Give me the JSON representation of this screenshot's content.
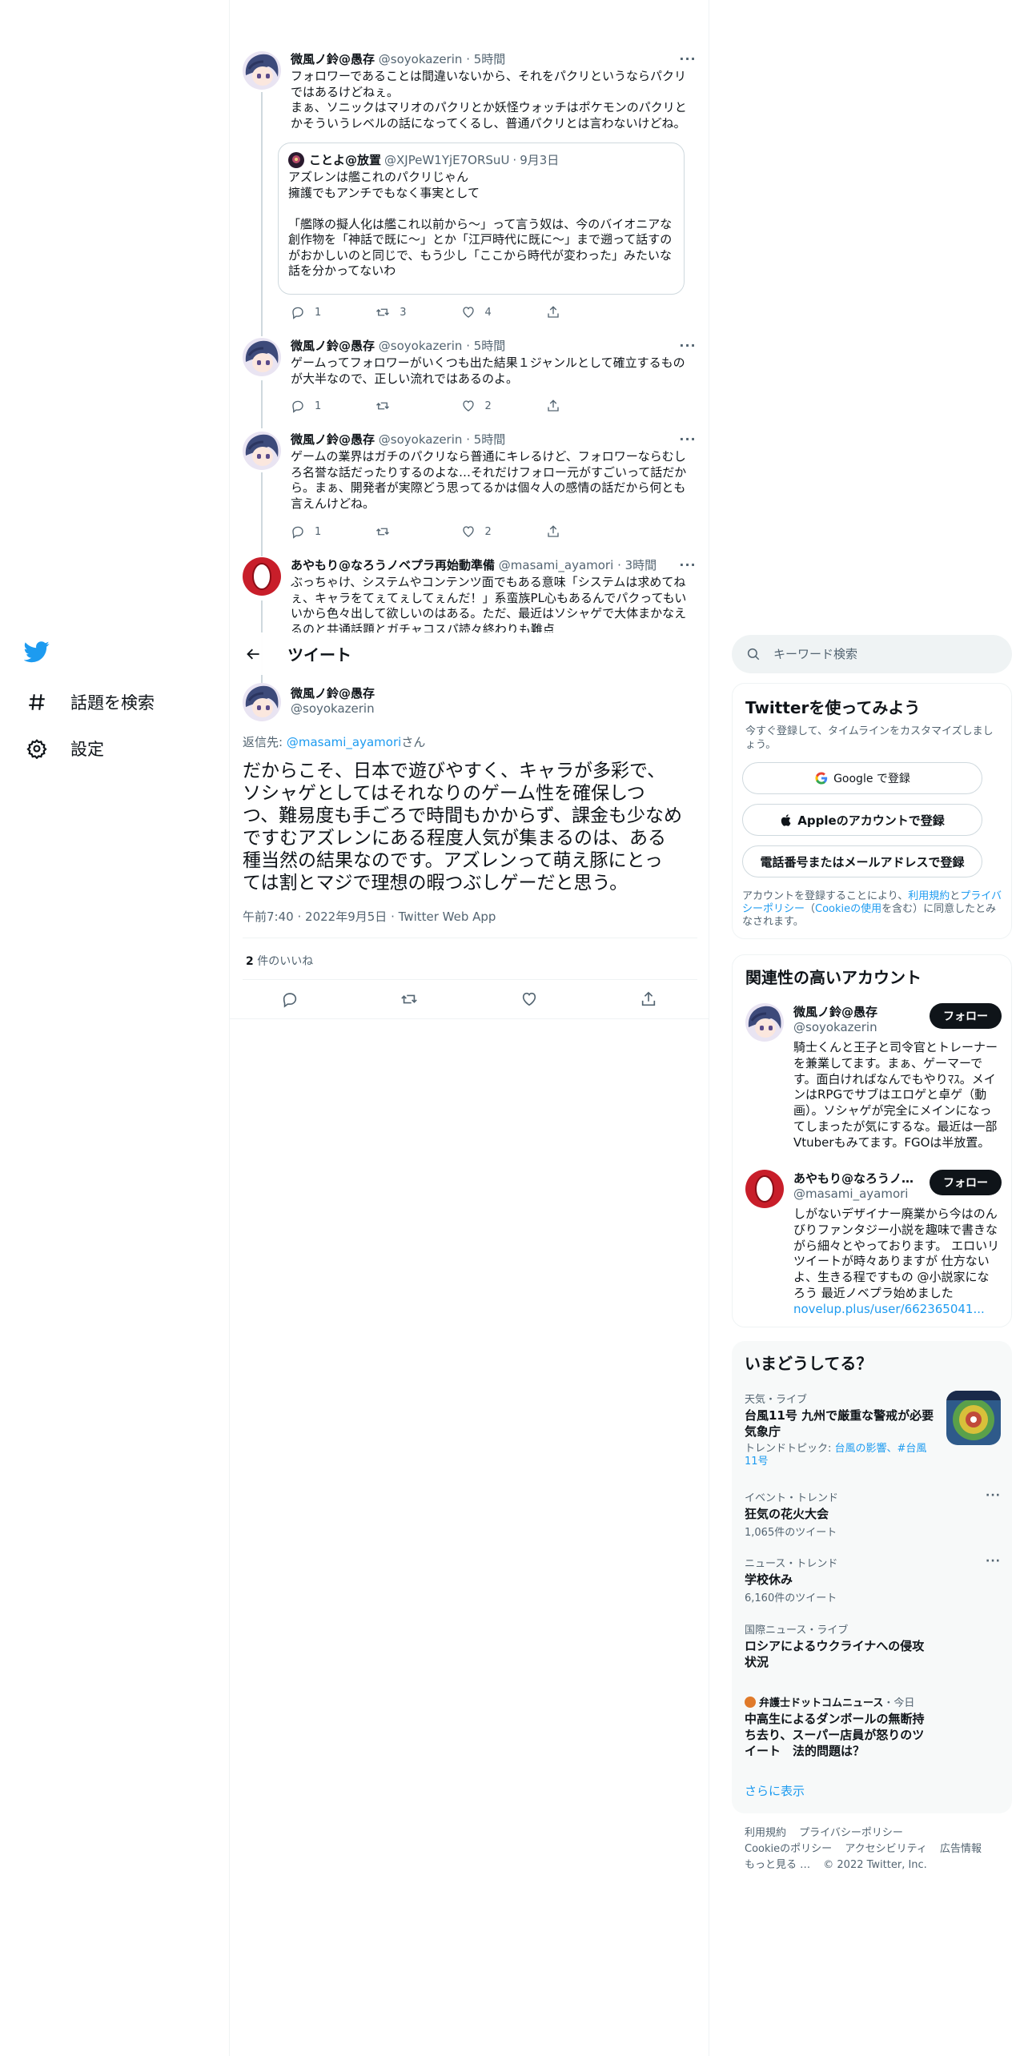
{
  "nav": {
    "logo": "twitter-bird-icon",
    "items": [
      {
        "icon": "hashtag-icon",
        "label": "話題を検索"
      },
      {
        "icon": "gear-icon",
        "label": "設定"
      }
    ]
  },
  "thread": [
    {
      "name": "微風ノ鈴@愚存",
      "handle": "@soyokazerin",
      "time": "5時間",
      "text": "フォロワーであることは間違いないから、それをパクリというならパクリ\nではあるけどねぇ。\nまぁ、ソニックはマリオのパクリとか妖怪ウォッチはポケモンのパクリと\nかそういうレベルの話になってくるし、普通パクリとは言わないけどね。",
      "quote": {
        "name": "ことよ@放置",
        "handle": "@XJPeW1YjE7ORSuU",
        "date": "9月3日",
        "text": "アズレンは艦これのパクリじゃん\n擁護でもアンチでもなく事実として\n\n「艦隊の擬人化は艦これ以前から〜」って言う奴は、今のバイオニアな\n創作物を「神話で既に〜」とか「江戸時代に既に〜」まで遡って話すの\nがおかしいのと同じで、もう少し「ここから時代が変わった」みたいな\n話を分かってないわ"
      },
      "replies": "1",
      "retweets": "3",
      "likes": "4"
    },
    {
      "name": "微風ノ鈴@愚存",
      "handle": "@soyokazerin",
      "time": "5時間",
      "text": "ゲームってフォロワーがいくつも出た結果１ジャンルとして確立するもの\nが大半なので、正しい流れではあるのよ。",
      "replies": "1",
      "retweets": "",
      "likes": "2"
    },
    {
      "name": "微風ノ鈴@愚存",
      "handle": "@soyokazerin",
      "time": "5時間",
      "text": "ゲームの業界はガチのパクリなら普通にキレるけど、フォロワーならむし\nろ名誉な話だったりするのよな…それだけフォロー元がすごいって話だか\nら。まぁ、開発者が実際どう思ってるかは個々人の感情の話だから何とも\n言えんけどね。",
      "replies": "1",
      "retweets": "",
      "likes": "2"
    },
    {
      "name": "あやもり@なろうノベプラ再始動準備",
      "handle": "@masami_ayamori",
      "time": "3時間",
      "text": "ぶっちゃけ、システムやコンテンツ面でもある意味「システムは求めてね\nぇ、キャラをてぇてぇしてぇんだ！」系蛮族PL心もあるんでパクってもい\nいから色々出して欲しいのはある。ただ、最近はソシャゲで大体まかなえ\nるのと共通話題とガチャコスパ読々終わりも難点"
    }
  ],
  "header": {
    "title": "ツイート"
  },
  "focused": {
    "name": "微風ノ鈴@愚存",
    "handle": "@soyokazerin",
    "reply_prefix": "返信先: ",
    "reply_to": "@masami_ayamori",
    "reply_suffix": "さん",
    "text": "だからこそ、日本で遊びやすく、キャラが多彩で、\nソシャゲとしてはそれなりのゲーム性を確保しつ\nつ、難易度も手ごろで時間もかからず、課金も少なめ\nですむアズレンにある程度人気が集まるのは、ある\n種当然の結果なのです。アズレンって萌え豚にとっ\nては割とマジで理想の暇つぶしゲーだと思う。",
    "time": "午前7:40",
    "date": "2022年9月5日",
    "source": "Twitter Web App",
    "like_count": "2",
    "like_label": " 件のいいね"
  },
  "sidebar": {
    "search_placeholder": "キーワード検索",
    "signup": {
      "title": "Twitterを使ってみよう",
      "subtitle": "今すぐ登録して、タイムラインをカスタマイズしましょう。",
      "google": "Google で登録",
      "apple": "Appleのアカウントで登録",
      "phone": "電話番号またはメールアドレスで登録",
      "legal_1": "アカウントを登録することにより、",
      "legal_terms": "利用規約",
      "legal_2": "と",
      "legal_privacy": "プライバシーポリシー",
      "legal_3": "（",
      "legal_cookie": "Cookieの使用",
      "legal_4": "を含む）に同意したとみなされます。"
    },
    "related": {
      "title": "関連性の高いアカウント",
      "accounts": [
        {
          "name": "微風ノ鈴@愚存",
          "handle": "@soyokazerin",
          "follow": "フォロー",
          "bio": "騎士くんと王子と司令官とトレーナーを兼業してます。まぁ、ゲーマーです。面白ければなんでもやりﾏｽ。メインはRPGでサブはエロゲと卓ゲ（動画）。ソシャゲが完全にメインになってしまったが気にするな。最近は一部Vtuberもみてます。FGOは半放置。"
        },
        {
          "name": "あやもり@なろうノベプラ再始動準備",
          "handle": "@masami_ayamori",
          "follow": "フォロー",
          "bio": "しがないデザイナー廃業から今はのんびりファンタジー小説を趣味で書きながら細々とやっております。 エロいリツイートが時々ありますが 仕方ないよ、生きる程ですもの @小説家になろう 最近ノベプラ始めました",
          "link": "novelup.plus/user/662365041..."
        }
      ]
    },
    "trends": {
      "title": "いまどうしてる？",
      "items": [
        {
          "meta": "天気・ライブ",
          "name": "台風11号 九州で厳重な警戒が必要\n気象庁",
          "sub_prefix": "トレンドトピック: ",
          "sub_link": "台風の影響、#台風11号"
        },
        {
          "meta": "イベント・トレンド",
          "name": "狂気の花火大会",
          "count": "1,065件のツイート"
        },
        {
          "meta": "ニュース・トレンド",
          "name": "学校休み",
          "count": "6,160件のツイート"
        },
        {
          "meta": "国際ニュース・ライブ",
          "name": "ロシアによるウクライナへの侵攻\n状況"
        },
        {
          "source": "弁護士ドットコムニュース",
          "meta_time": "・今日",
          "name": "中高生によるダンボールの無断持\nち去り、スーパー店員が怒りのツ\nイート　法的問題は？"
        }
      ],
      "show_more": "さらに表示"
    },
    "footer": {
      "terms": "利用規約",
      "privacy": "プライバシーポリシー",
      "cookie": "Cookieのポリシー",
      "accessibility": "アクセシビリティ",
      "ads": "広告情報",
      "more": "もっと見る …",
      "copyright": "© 2022 Twitter, Inc."
    }
  },
  "colors": {
    "accent": "#1d9bf0",
    "text": "#0f1419",
    "secondary": "#536471",
    "border": "#eff3f4"
  }
}
